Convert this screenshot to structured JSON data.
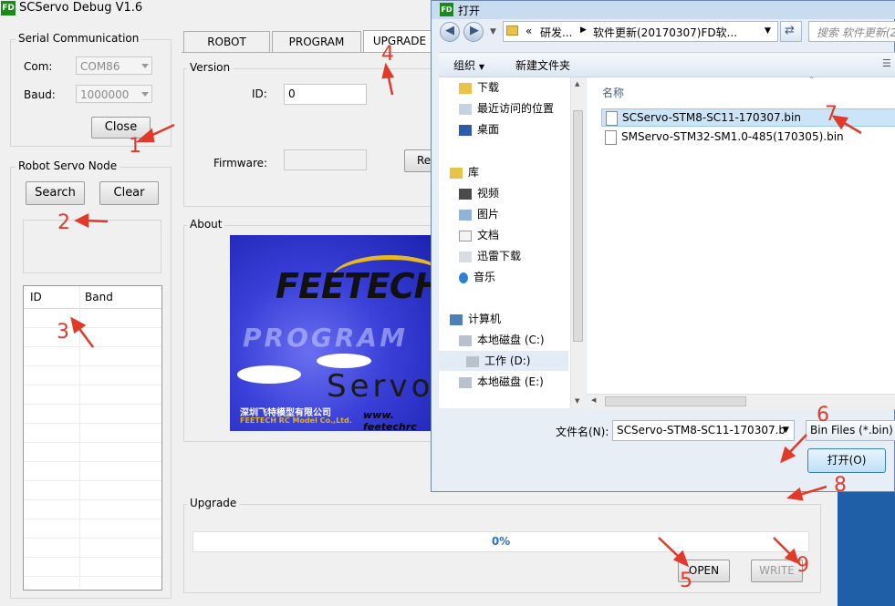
{
  "app": {
    "icon_text": "FD",
    "title": "SCServo Debug V1.6"
  },
  "serial": {
    "group_label": "Serial Communication",
    "com_label": "Com:",
    "com_value": "COM86",
    "baud_label": "Baud:",
    "baud_value": "1000000",
    "close_button": "Close"
  },
  "servo_node": {
    "group_label": "Robot Servo Node",
    "search_button": "Search",
    "clear_button": "Clear",
    "table_headers": [
      "ID",
      "Band"
    ]
  },
  "tabs": [
    "ROBOT",
    "PROGRAM",
    "UPGRADE"
  ],
  "version": {
    "group_label": "Version",
    "id_label": "ID:",
    "id_value": "0",
    "firmware_label": "Firmware:",
    "firmware_value": "",
    "read_button": "Re"
  },
  "about": {
    "group_label": "About",
    "logo_brand": "FEETECH",
    "logo_program": "PROGRAM",
    "logo_servo": "Servo",
    "logo_cn": "深圳飞特模型有限公司",
    "logo_en": "FEETECH RC Model Co.,Ltd.",
    "logo_url": "www. feetechrc"
  },
  "upgrade": {
    "group_label": "Upgrade",
    "progress": 0,
    "progress_text": "0%",
    "open_button": "OPEN",
    "write_button": "WRITE"
  },
  "dialog": {
    "icon_text": "FD",
    "title": "打开",
    "path_prefix": "«",
    "path_part1": "研发...",
    "path_part2": "软件更新(20170307)FD软...",
    "search_placeholder": "搜索 软件更新(2",
    "organize": "组织",
    "new_folder": "新建文件夹",
    "nav_items": [
      "下载",
      "最近访问的位置",
      "桌面",
      "库",
      "视频",
      "图片",
      "文档",
      "迅雷下载",
      "音乐",
      "计算机",
      "本地磁盘 (C:)",
      "工作 (D:)",
      "本地磁盘 (E:)"
    ],
    "column_name": "名称",
    "files": [
      "SCServo-STM8-SC11-170307.bin",
      "SMServo-STM32-SM1.0-485(170305).bin"
    ],
    "filename_label": "文件名(N):",
    "filename_value": "SCServo-STM8-SC11-170307.b",
    "filter_value": "Bin Files (*.bin)",
    "open_button": "打开(O)"
  },
  "annotations": [
    "1",
    "2",
    "3",
    "4",
    "5",
    "6",
    "7",
    "8",
    "9"
  ],
  "colors": {
    "annotation": "#e23a2a",
    "progress_text": "#2a6fd0",
    "dialog_frame": "#6b87a8",
    "selected_file": "#cce4f7"
  }
}
